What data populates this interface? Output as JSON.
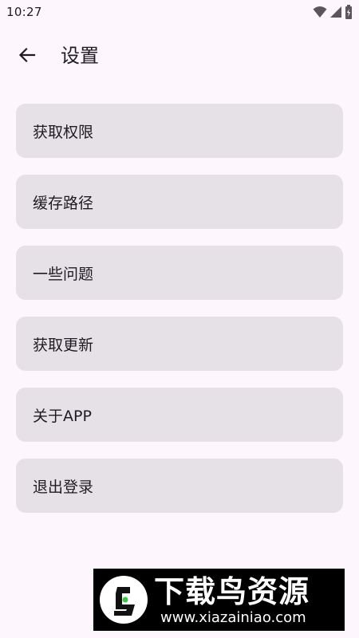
{
  "status_bar": {
    "time": "10:27",
    "icons": [
      "wifi-icon",
      "signal-icon",
      "battery-icon"
    ]
  },
  "app_bar": {
    "back_icon": "arrow-left-icon",
    "title": "设置"
  },
  "settings": {
    "items": [
      {
        "label": "获取权限"
      },
      {
        "label": "缓存路径"
      },
      {
        "label": "一些问题"
      },
      {
        "label": "获取更新"
      },
      {
        "label": "关于APP"
      },
      {
        "label": "退出登录"
      }
    ]
  },
  "watermark": {
    "title": "下载鸟资源",
    "url": "www.xiazainiao.com"
  },
  "colors": {
    "background": "#fdf7fd",
    "item_background": "#e6e1e6",
    "text": "#1f1b22",
    "watermark_accent": "#2ecc40"
  }
}
